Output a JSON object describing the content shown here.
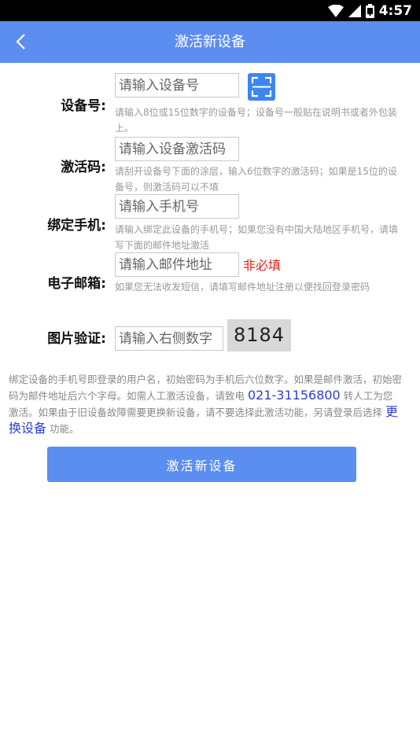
{
  "status_bar": {
    "time": "4:57"
  },
  "header": {
    "title": "激活新设备"
  },
  "form": {
    "device_number": {
      "label": "设备号:",
      "placeholder": "请输入设备号",
      "hint": "请输入8位或15位数字的设备号；设备号一般贴在说明书或者外包装上。"
    },
    "activation_code": {
      "label": "激活码:",
      "placeholder": "请输入设备激活码",
      "hint": "请刮开设备号下面的涂层，输入6位数字的激活码；如果是15位的设备号，则激活码可以不填"
    },
    "bound_phone": {
      "label": "绑定手机:",
      "placeholder": "请输入手机号",
      "hint": "请输入绑定此设备的手机号；如果您没有中国大陆地区手机号，请填写下面的邮件地址激活"
    },
    "email": {
      "label": "电子邮箱:",
      "placeholder": "请输入邮件地址",
      "optional_note": "非必填",
      "hint": "如果您无法收发短信，请填写邮件地址注册以便找回登录密码"
    },
    "captcha": {
      "label": "图片验证:",
      "placeholder": "请输入右侧数字",
      "code": "8184"
    }
  },
  "notice": {
    "part1": "绑定设备的手机号即登录的用户名，初始密码为手机后六位数字。如果是邮件激活，初始密码为邮件地址后六个字母。如需人工激活设备，请致电 ",
    "phone": "021-31156800",
    "part2": " 转人工为您激活。如果由于旧设备故障需要更换新设备，请不要选择此激活功能，另请登录后选择 ",
    "link": "更换设备",
    "part3": " 功能。"
  },
  "actions": {
    "activate_label": "激活新设备"
  },
  "colors": {
    "primary": "#5b8ef0",
    "scan_button": "#3d86f0",
    "optional": "#e0201a",
    "link": "#2b3fd0"
  }
}
